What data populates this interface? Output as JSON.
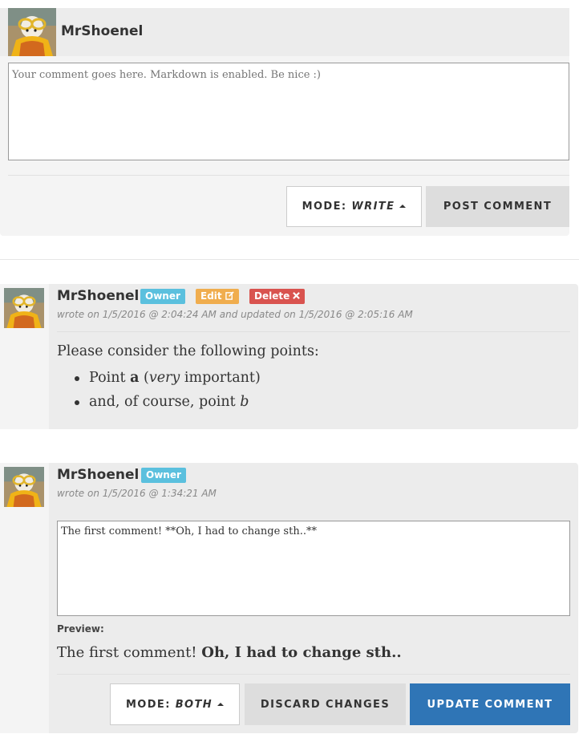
{
  "new_comment": {
    "username": "MrShoenel",
    "placeholder": "Your comment goes here. Markdown is enabled. Be nice :)",
    "mode_prefix": "Mode:",
    "mode_value": "Write",
    "post_label": "Post Comment"
  },
  "comments": [
    {
      "username": "MrShoenel",
      "badges": {
        "owner": "Owner",
        "edit": "Edit",
        "delete": "Delete"
      },
      "meta": "wrote on 1/5/2016 @ 2:04:24 AM and updated on 1/5/2016 @ 2:05:16 AM",
      "content": {
        "intro": "Please consider the following points:",
        "point1": {
          "pre": "Point ",
          "bold": "a",
          "mid": " (",
          "italic": "very",
          "post": " important)"
        },
        "point2": {
          "pre": "and, of course, point ",
          "italic": "b"
        }
      }
    },
    {
      "username": "MrShoenel",
      "badges": {
        "owner": "Owner"
      },
      "meta": "wrote on 1/5/2016 @ 1:34:21 AM",
      "editor_value": "The first comment! **Oh, I had to change sth..**",
      "preview_label": "Preview:",
      "preview": {
        "plain": "The first comment! ",
        "bold": "Oh, I had to change sth.."
      },
      "mode_prefix": "Mode:",
      "mode_value": "Both",
      "discard_label": "Discard Changes",
      "update_label": "Update Comment"
    }
  ],
  "icons": {
    "avatar": "avatar-image",
    "edit": "edit-square-icon",
    "delete": "close-x-icon",
    "caret": "caret-up-icon"
  },
  "colors": {
    "owner_badge": "#5bc0de",
    "edit_badge": "#f0ad4e",
    "delete_badge": "#d9534f",
    "primary_button": "#2f75b6"
  }
}
